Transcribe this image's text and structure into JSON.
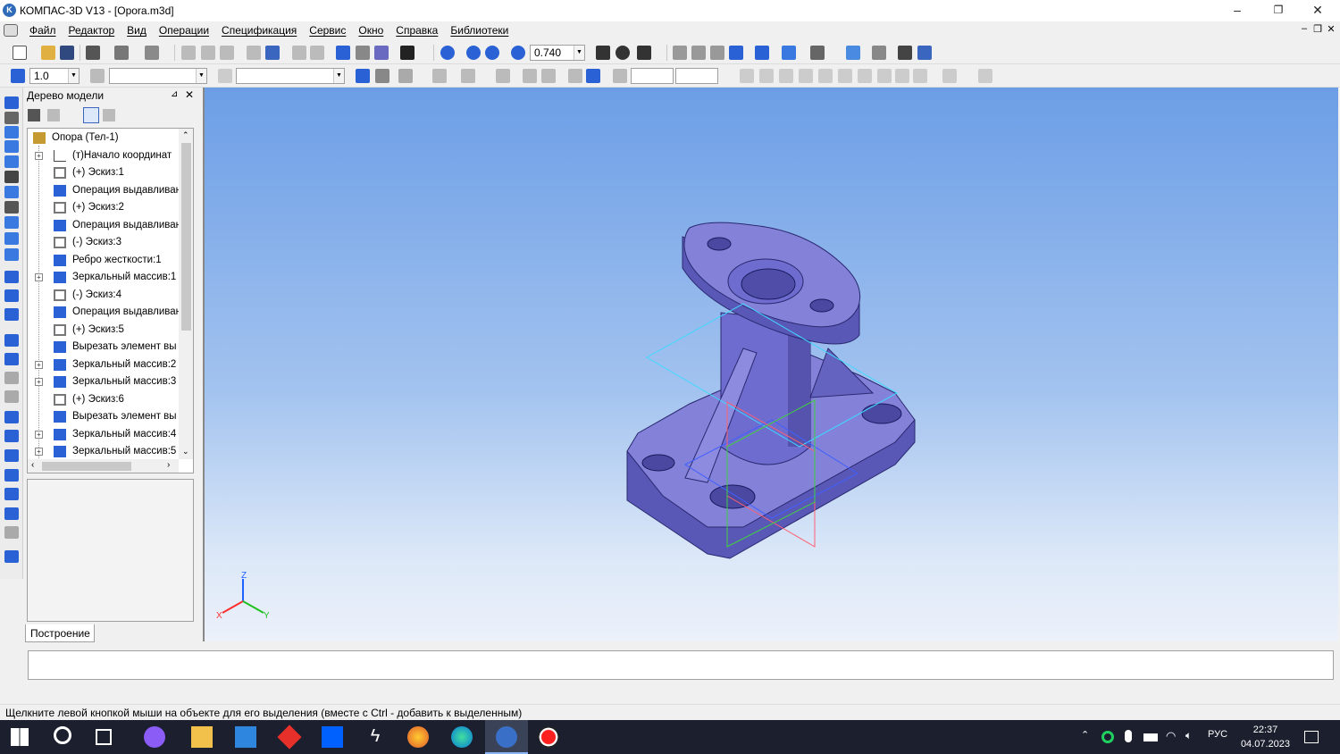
{
  "window": {
    "title": "КОМПАС-3D V13 - [Opora.m3d]",
    "minimize_glyph": "–",
    "restore_glyph": "❐",
    "close_glyph": "✕"
  },
  "menu": {
    "items": [
      "Файл",
      "Редактор",
      "Вид",
      "Операции",
      "Спецификация",
      "Сервис",
      "Окно",
      "Справка",
      "Библиотеки"
    ]
  },
  "toolbar1": {
    "zoom_value": "0.740"
  },
  "toolbar2": {
    "step_value": "1.0"
  },
  "tree": {
    "header": "Дерево модели",
    "items": [
      {
        "label": "Опора (Тел-1)",
        "icon": "part-icon",
        "color": "#c59a30"
      },
      {
        "label": "(т)Начало координат",
        "icon": "origin-icon",
        "color": "#444444"
      },
      {
        "label": "(+) Эскиз:1",
        "icon": "sketch-icon",
        "color": "#777777"
      },
      {
        "label": "Операция выдавливан",
        "icon": "extrude-icon",
        "color": "#2a62d6"
      },
      {
        "label": "(+) Эскиз:2",
        "icon": "sketch-icon",
        "color": "#777777"
      },
      {
        "label": "Операция выдавливан",
        "icon": "extrude-icon",
        "color": "#2a62d6"
      },
      {
        "label": "(-) Эскиз:3",
        "icon": "sketch-icon",
        "color": "#777777"
      },
      {
        "label": "Ребро жесткости:1",
        "icon": "rib-icon",
        "color": "#2a62d6"
      },
      {
        "label": "Зеркальный массив:1",
        "icon": "mirror-icon",
        "color": "#2a62d6"
      },
      {
        "label": "(-) Эскиз:4",
        "icon": "sketch-icon",
        "color": "#777777"
      },
      {
        "label": "Операция выдавливан",
        "icon": "extrude-icon",
        "color": "#2a62d6"
      },
      {
        "label": "(+) Эскиз:5",
        "icon": "sketch-icon",
        "color": "#777777"
      },
      {
        "label": "Вырезать элемент вы",
        "icon": "cut-icon",
        "color": "#2a62d6"
      },
      {
        "label": "Зеркальный массив:2",
        "icon": "mirror-icon",
        "color": "#2a62d6"
      },
      {
        "label": "Зеркальный массив:3",
        "icon": "mirror-icon",
        "color": "#2a62d6"
      },
      {
        "label": "(+) Эскиз:6",
        "icon": "sketch-icon",
        "color": "#777777"
      },
      {
        "label": "Вырезать элемент вы",
        "icon": "cut-icon",
        "color": "#2a62d6"
      },
      {
        "label": "Зеркальный массив:4",
        "icon": "mirror-icon",
        "color": "#2a62d6"
      },
      {
        "label": "Зеркальный массив:5",
        "icon": "mirror-icon",
        "color": "#2a62d6"
      }
    ],
    "tab": "Построение"
  },
  "axes": {
    "x": "X",
    "y": "Y",
    "z": "Z"
  },
  "status": {
    "text": "Щелкните левой кнопкой мыши на объекте для его выделения (вместе с Ctrl - добавить к выделенным)"
  },
  "taskbar": {
    "lang": "РУС",
    "time": "22:37",
    "date": "04.07.2023"
  },
  "colors": {
    "model": "#7a78d6",
    "viewport_top": "#6c9ee6",
    "viewport_bottom": "#ecf1fa",
    "taskbar": "#1b1f2e"
  }
}
